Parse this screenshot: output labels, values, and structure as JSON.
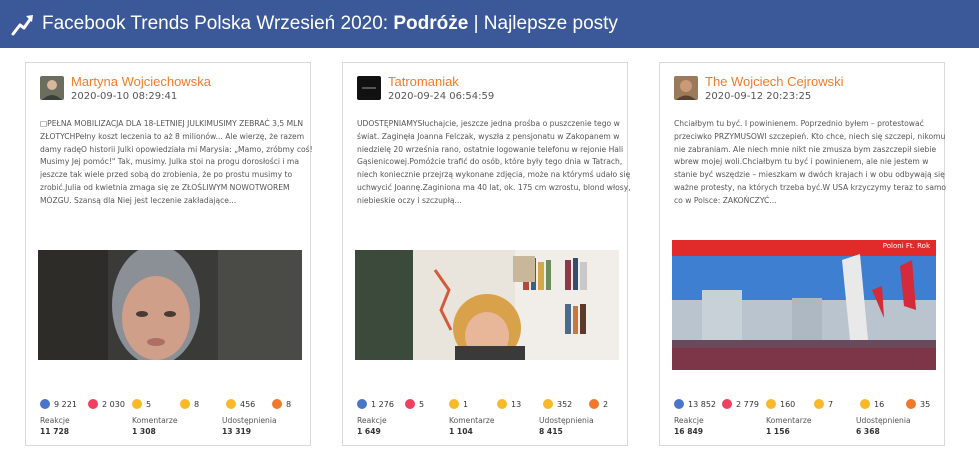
{
  "header": {
    "title_prefix": "Facebook Trends Polska Wrzesień 2020: ",
    "title_bold": "Podróże",
    "title_suffix": " | Najlepsze posty"
  },
  "reaction_colors": {
    "like": "#4a76c9",
    "love": "#f0405f",
    "haha": "#f7b928",
    "wow": "#f7b928",
    "sad": "#f7b928",
    "angry": "#f0782a"
  },
  "stat_labels": {
    "reactions": "Reakcje",
    "comments": "Komentarze",
    "shares": "Udostępnienia"
  },
  "posts": [
    {
      "author": "Martyna Wojciechowska",
      "date": "2020-09-10 08:29:41",
      "text": "□PEŁNA MOBILIZACJA DLA 18-LETNIEJ JULKIMUSIMY ZEBRAĆ 3,5 MLN ZŁOTYCHPełny koszt leczenia to aż 8 milionów... Ale wierzę, że razem damy radęO historii Julki opowiedziała mi Marysia: „Mamo, zróbmy coś! Musimy Jej pomóc!\" Tak, musimy. Julka stoi na progu dorosłości i ma jeszcze tak wiele przed sobą do zrobienia, że po prostu musimy to zrobić.Julia od kwietnia zmaga się ze ZŁOŚLIWYM NOWOTWOREM MÓZGU. Szansą dla Niej jest leczenie zakładające...",
      "reactions": {
        "like": "9 221",
        "love": "2 030",
        "haha": "5",
        "wow": "8",
        "sad": "456",
        "angry": "8"
      },
      "totals": {
        "reactions": "11 728",
        "comments": "1 308",
        "shares": "13 319"
      }
    },
    {
      "author": "Tatromaniak",
      "date": "2020-09-24 06:54:59",
      "text": "UDOSTĘPNIAMYSłuchajcie, jeszcze jedna prośba o puszczenie tego w świat. Zaginęła Joanna Felczak, wyszła z pensjonatu w Zakopanem w niedzielę 20 września rano, ostatnie logowanie telefonu w rejonie Hali Gąsienicowej.Pomóżcie trafić do osób, które były tego dnia w Tatrach, niech koniecznie przejrzą wykonane zdjęcia, może na którymś udało się uchwycić Joannę.Zaginiona ma 40 lat, ok. 175 cm wzrostu, blond włosy, niebieskie oczy i szczupłą...",
      "reactions": {
        "like": "1 276",
        "love": "5",
        "haha": "1",
        "wow": "13",
        "sad": "352",
        "angry": "2"
      },
      "totals": {
        "reactions": "1 649",
        "comments": "1 104",
        "shares": "8 415"
      }
    },
    {
      "author": "The Wojciech Cejrowski",
      "date": "2020-09-12 20:23:25",
      "text": "Chciałbym tu być. I powinienem. Poprzednio byłem – protestować przeciwko PRZYMUSOWI szczepień. Kto chce, niech się szczepi, nikomu nie zabraniam. Ale niech mnie nikt nie zmusza bym zaszczepił siebie wbrew mojej woli.Chciałbym tu być i powinienem, ale nie jestem w stanie być wszędzie – mieszkam w dwóch krajach i w obu odbywają się ważne protesty, na których trzeba być.W USA krzyczymy teraz to samo co w Polsce: ZAKOŃCZYĆ...",
      "photo_caption": "Poloni Ft. Rok",
      "reactions": {
        "like": "13 852",
        "love": "2 779",
        "haha": "160",
        "wow": "7",
        "sad": "16",
        "angry": "35"
      },
      "totals": {
        "reactions": "16 849",
        "comments": "1 156",
        "shares": "6 368"
      }
    }
  ]
}
